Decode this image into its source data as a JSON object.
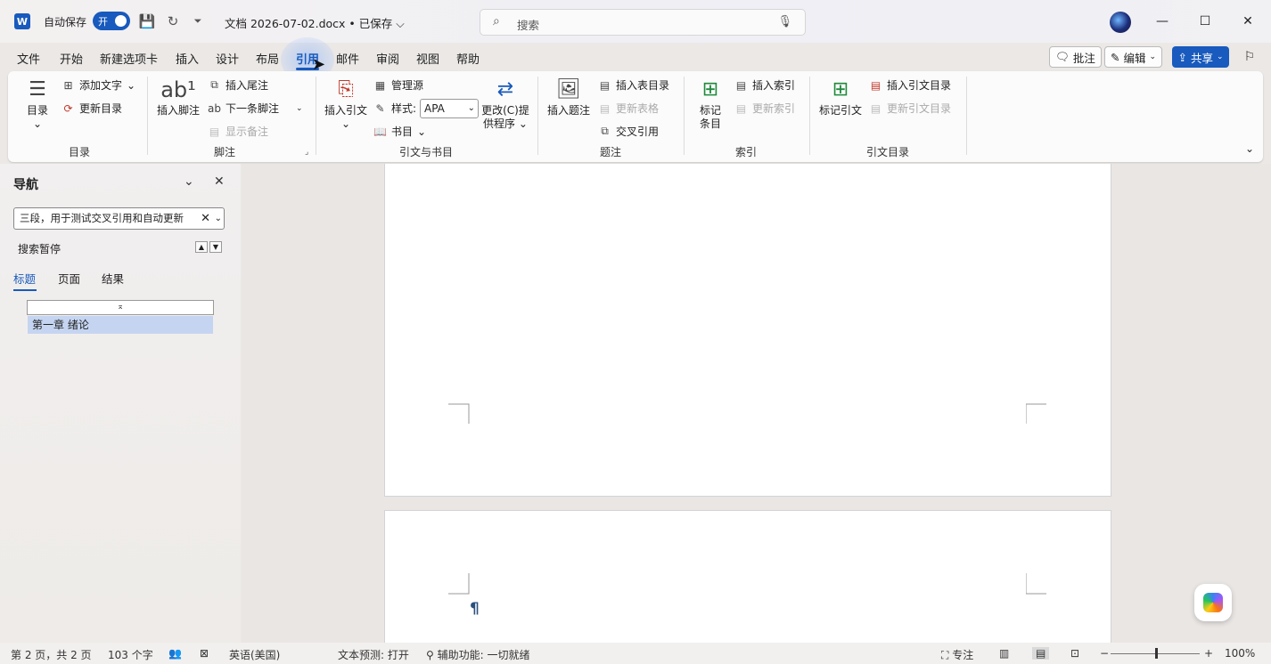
{
  "titlebar": {
    "autosave_label": "自动保存",
    "autosave_state": "开",
    "doc_title": "文档 2026-07-02.docx • 已保存 ⌵",
    "search_placeholder": "搜索"
  },
  "menu": {
    "tabs": [
      "文件",
      "开始",
      "新建选项卡",
      "插入",
      "设计",
      "布局",
      "引用",
      "邮件",
      "审阅",
      "视图",
      "帮助"
    ],
    "active_tab": "引用",
    "comments_label": "批注",
    "editing_label": "编辑",
    "share_label": "共享"
  },
  "ribbon": {
    "toc": {
      "big": "目录",
      "add_text": "添加文字",
      "update_toc": "更新目录",
      "group": "目录"
    },
    "footnotes": {
      "big": "插入脚注",
      "insert_endnote": "插入尾注",
      "next_footnote": "下一条脚注",
      "show_notes": "显示备注",
      "group": "脚注"
    },
    "citations": {
      "big": "插入引文",
      "manage_sources": "管理源",
      "style_label": "样式:",
      "style_value": "APA",
      "bibliography": "书目",
      "change_provider": "更改(C)提供程序",
      "group": "引文与书目"
    },
    "captions": {
      "big": "插入题注",
      "insert_table_of_figures": "插入表目录",
      "update_table": "更新表格",
      "cross_reference": "交叉引用",
      "group": "题注"
    },
    "index": {
      "big": "标记条目",
      "insert_index": "插入索引",
      "update_index": "更新索引",
      "group": "索引"
    },
    "toa": {
      "big": "标记引文",
      "insert_toa": "插入引文目录",
      "update_toa": "更新引文目录",
      "group": "引文目录"
    }
  },
  "nav": {
    "title": "导航",
    "search_value": "三段，用于测试交叉引用和自动更新",
    "status": "搜索暂停",
    "tabs": [
      "标题",
      "页面",
      "结果"
    ],
    "active_tab": "标题",
    "heading": "第一章 绪论"
  },
  "statusbar": {
    "page": "第 2 页，共 2 页",
    "words": "103 个字",
    "language": "英语(美国)",
    "text_prediction": "文本预测: 打开",
    "accessibility": "辅助功能: 一切就绪",
    "focus": "专注",
    "zoom": "100%"
  },
  "colors": {
    "accent": "#185abd",
    "nav_highlight": "#c5d5f1"
  }
}
